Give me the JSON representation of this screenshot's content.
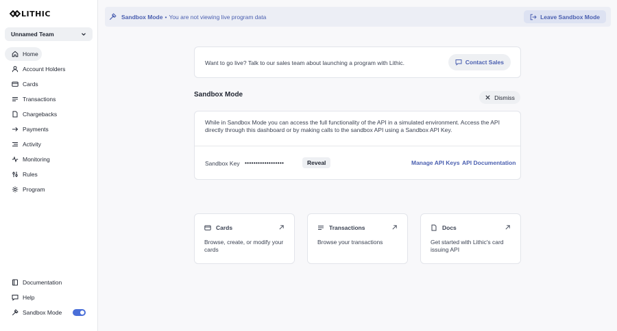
{
  "brand": {
    "name": "LITHIC"
  },
  "team": {
    "selected": "Unnamed Team"
  },
  "nav": [
    {
      "label": "Home",
      "icon": "home-icon",
      "active": true
    },
    {
      "label": "Account Holders",
      "icon": "user-icon"
    },
    {
      "label": "Cards",
      "icon": "card-icon"
    },
    {
      "label": "Transactions",
      "icon": "list-icon"
    },
    {
      "label": "Chargebacks",
      "icon": "document-icon"
    },
    {
      "label": "Payments",
      "icon": "arrow-right-icon"
    },
    {
      "label": "Activity",
      "icon": "activity-icon"
    },
    {
      "label": "Monitoring",
      "icon": "monitoring-icon"
    },
    {
      "label": "Rules",
      "icon": "rules-icon"
    },
    {
      "label": "Program",
      "icon": "gear-icon"
    }
  ],
  "nav_bottom": {
    "documentation": "Documentation",
    "help": "Help",
    "sandbox_mode": "Sandbox Mode",
    "sandbox_toggle_on": true
  },
  "banner": {
    "title": "Sandbox Mode",
    "separator": "•",
    "text": "You are not viewing live program data",
    "leave_label": "Leave Sandbox Mode"
  },
  "contact": {
    "text": "Want to go live? Talk to our sales team about launching a program with Lithic.",
    "button": "Contact Sales"
  },
  "sandbox": {
    "title": "Sandbox Mode",
    "dismiss": "Dismiss",
    "description": "While in Sandbox Mode you can access the full functionality of the API in a simulated environment. Access the API directly through this dashboard or by making calls to the sandbox API using a Sandbox API Key.",
    "key_label": "Sandbox Key",
    "key_value": "••••••••••••••••••",
    "reveal": "Reveal",
    "manage_keys": "Manage API Keys",
    "api_docs": "API Documentation"
  },
  "quick_links": [
    {
      "title": "Cards",
      "icon": "card-icon",
      "description": "Browse, create, or modify your cards"
    },
    {
      "title": "Transactions",
      "icon": "list-icon",
      "description": "Browse your transactions"
    },
    {
      "title": "Docs",
      "icon": "document-icon",
      "description": "Get started with Lithic's card issuing API"
    }
  ],
  "colors": {
    "accent": "#4a5fb0",
    "toggle": "#4a6fd8"
  }
}
